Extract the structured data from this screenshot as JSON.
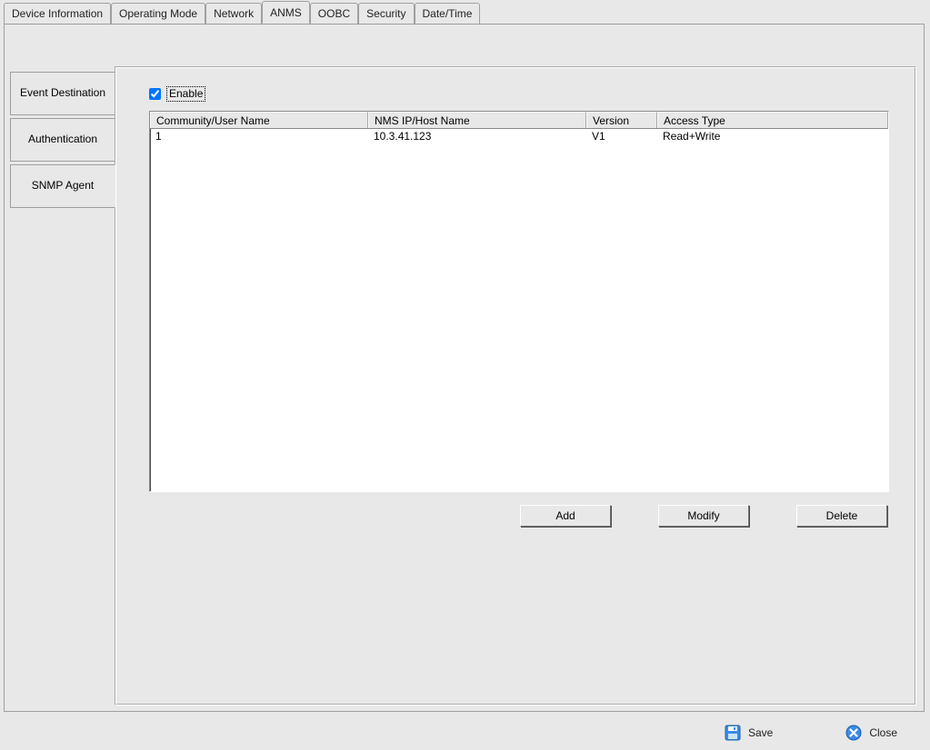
{
  "topTabs": {
    "t0": "Device Information",
    "t1": "Operating Mode",
    "t2": "Network",
    "t3": "ANMS",
    "t4": "OOBC",
    "t5": "Security",
    "t6": "Date/Time"
  },
  "sideTabs": {
    "s0": "Event Destination",
    "s1": "Authentication",
    "s2": "SNMP Agent"
  },
  "enable": {
    "label": "Enable",
    "checked": true
  },
  "table": {
    "headers": {
      "h0": "Community/User Name",
      "h1": "NMS IP/Host Name",
      "h2": "Version",
      "h3": "Access Type"
    },
    "rows": [
      {
        "c0": "1",
        "c1": "10.3.41.123",
        "c2": "V1",
        "c3": "Read+Write"
      }
    ]
  },
  "buttons": {
    "add": "Add",
    "modify": "Modify",
    "delete": "Delete"
  },
  "bottom": {
    "save": "Save",
    "close": "Close"
  }
}
